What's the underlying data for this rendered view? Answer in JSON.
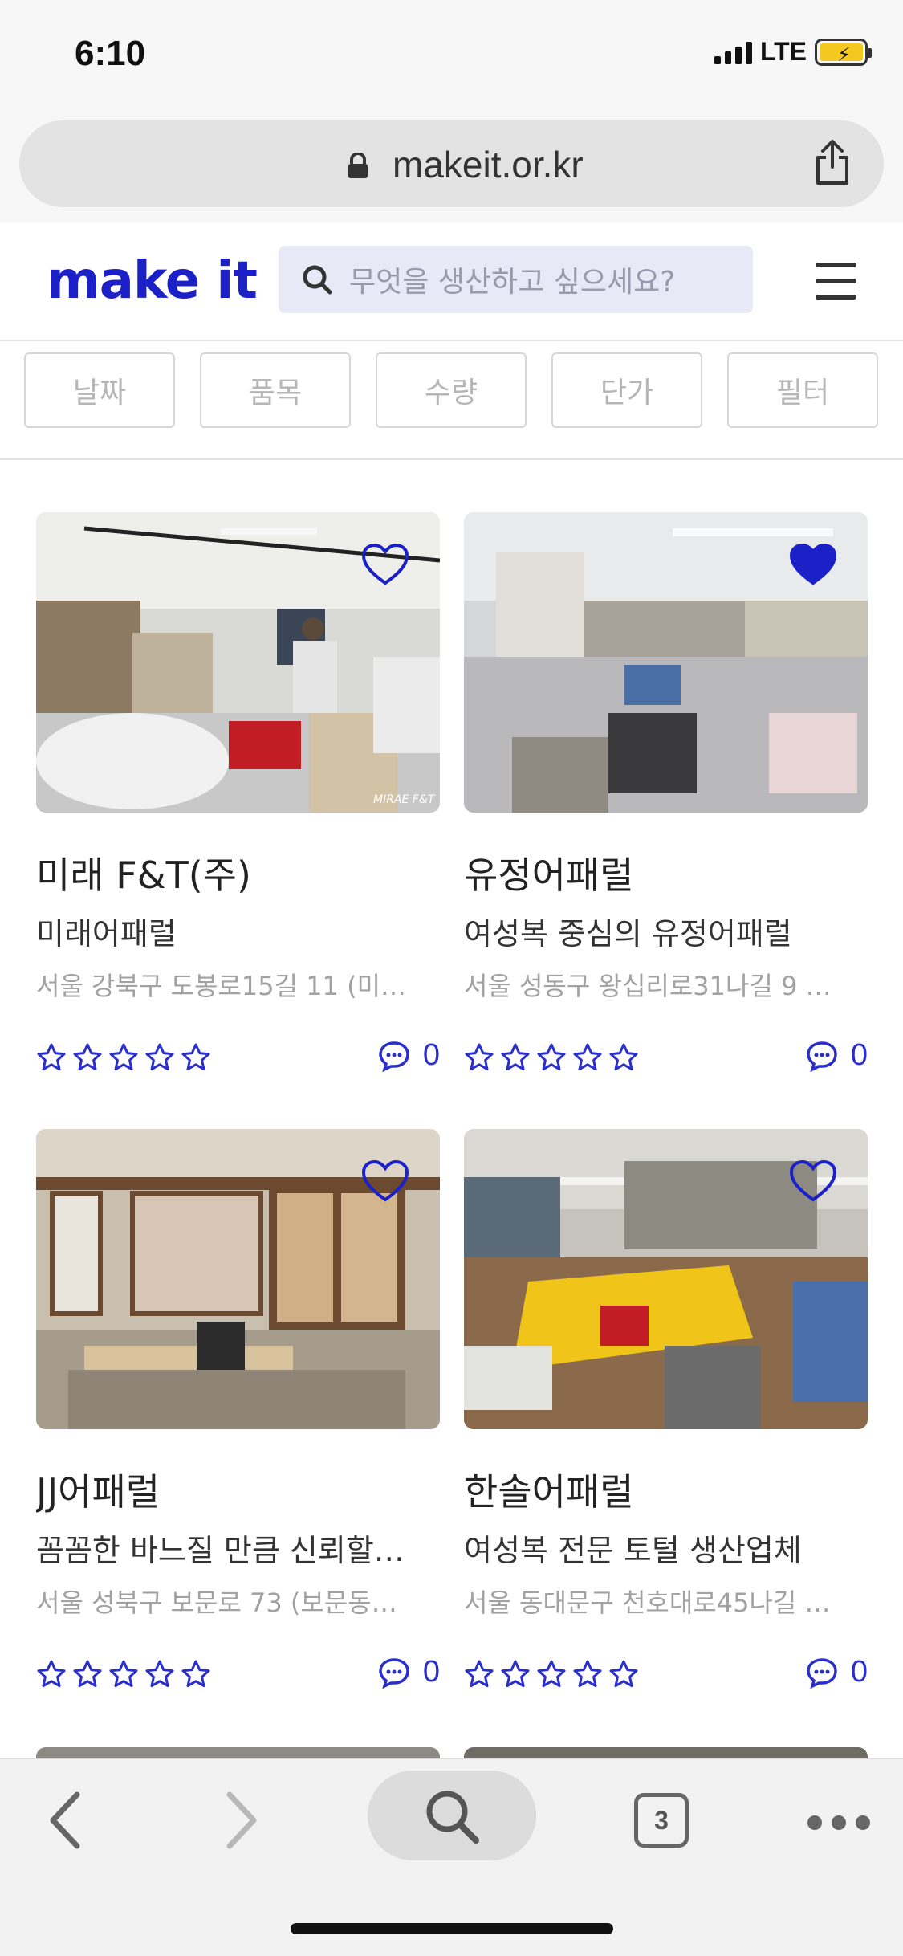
{
  "status_bar": {
    "time": "6:10",
    "network": "LTE"
  },
  "browser": {
    "url": "makeit.or.kr",
    "tab_count": "3"
  },
  "header": {
    "logo": "make it",
    "search_placeholder": "무엇을 생산하고 싶으세요?"
  },
  "filters": [
    "날짜",
    "품목",
    "수량",
    "단가",
    "필터"
  ],
  "colors": {
    "brand": "#1b21c7",
    "rating_star": "#2a2fc9",
    "heart_filled": "#1b21c7"
  },
  "cards": [
    {
      "name": "미래 F&T(주)",
      "desc": "미래어패럴",
      "addr": "서울 강북구 도봉로15길 11 (미…",
      "rating": 0,
      "comments": "0",
      "liked": false,
      "watermark": "MIRAE F&T"
    },
    {
      "name": "유정어패럴",
      "desc": "여성복 중심의 유정어패럴",
      "addr": "서울 성동구 왕십리로31나길 9 …",
      "rating": 0,
      "comments": "0",
      "liked": true
    },
    {
      "name": "JJ어패럴",
      "desc": "꼼꼼한 바느질 만큼 신뢰할…",
      "addr": "서울 성북구 보문로 73 (보문동…",
      "rating": 0,
      "comments": "0",
      "liked": false
    },
    {
      "name": "한솔어패럴",
      "desc": "여성복 전문 토털 생산업체",
      "addr": "서울 동대문구 천호대로45나길 …",
      "rating": 0,
      "comments": "0",
      "liked": false
    }
  ]
}
